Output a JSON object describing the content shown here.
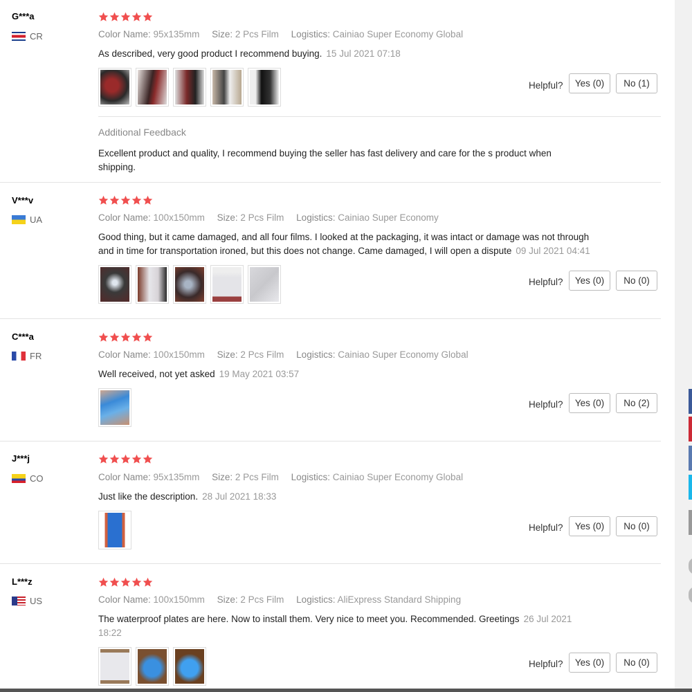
{
  "reviews": [
    {
      "user": "G***a",
      "country": "CR",
      "color_label": "Color Name:",
      "color_value": "95x135mm",
      "size_label": "Size:",
      "size_value": "2 Pcs Film",
      "logistics_label": "Logistics:",
      "logistics_value": "Cainiao Super Economy Global",
      "text": "As described, very good product I recommend buying.",
      "date": "15 Jul 2021 07:18",
      "rating": 5,
      "photos": 5,
      "helpful_label": "Helpful?",
      "yes": "Yes (0)",
      "no": "No (1)",
      "additional_title": "Additional Feedback",
      "additional_text": "Excellent product and quality, I recommend buying the seller has fast delivery and care for the s product when shipping."
    },
    {
      "user": "V***v",
      "country": "UA",
      "color_label": "Color Name:",
      "color_value": "100x150mm",
      "size_label": "Size:",
      "size_value": "2 Pcs Film",
      "logistics_label": "Logistics:",
      "logistics_value": "Cainiao Super Economy",
      "text": "Good thing, but it came damaged, and all four films. I looked at the packaging, it was intact or damage was not through and in time for transportation ironed, but this does not change. Came damaged, I will open a dispute",
      "date": "09 Jul 2021 04:41",
      "rating": 5,
      "photos": 5,
      "helpful_label": "Helpful?",
      "yes": "Yes (0)",
      "no": "No (0)"
    },
    {
      "user": "C***a",
      "country": "FR",
      "color_label": "Color Name:",
      "color_value": "100x150mm",
      "size_label": "Size:",
      "size_value": "2 Pcs Film",
      "logistics_label": "Logistics:",
      "logistics_value": "Cainiao Super Economy Global",
      "text": "Well received, not yet asked",
      "date": "19 May 2021 03:57",
      "rating": 5,
      "photos": 1,
      "helpful_label": "Helpful?",
      "yes": "Yes (0)",
      "no": "No (2)"
    },
    {
      "user": "J***j",
      "country": "CO",
      "color_label": "Color Name:",
      "color_value": "95x135mm",
      "size_label": "Size:",
      "size_value": "2 Pcs Film",
      "logistics_label": "Logistics:",
      "logistics_value": "Cainiao Super Economy Global",
      "text": "Just like the description.",
      "date": "28 Jul 2021 18:33",
      "rating": 5,
      "photos": 1,
      "helpful_label": "Helpful?",
      "yes": "Yes (0)",
      "no": "No (0)"
    },
    {
      "user": "L***z",
      "country": "US",
      "color_label": "Color Name:",
      "color_value": "100x150mm",
      "size_label": "Size:",
      "size_value": "2 Pcs Film",
      "logistics_label": "Logistics:",
      "logistics_value": "AliExpress Standard Shipping",
      "text": "The waterproof plates are here. Now to install them. Very nice to meet you. Recommended. Greetings",
      "date": "26 Jul 2021 18:22",
      "rating": 5,
      "photos": 3,
      "helpful_label": "Helpful?",
      "yes": "Yes (0)",
      "no": "No (0)"
    }
  ],
  "colors": {
    "star": "#f04f4f",
    "border": "#e3e3e3",
    "muted": "#999999"
  }
}
